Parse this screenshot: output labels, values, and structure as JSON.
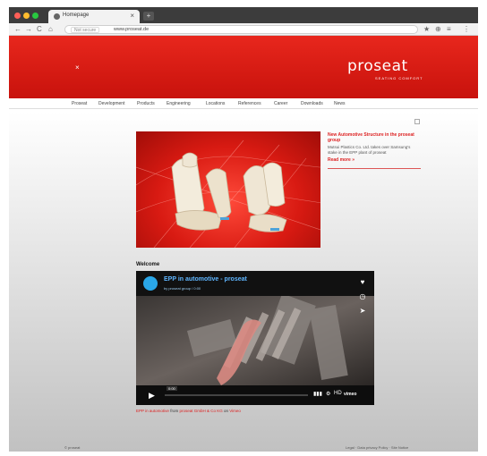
{
  "browser": {
    "tab_title": "Homepage",
    "tab_close": "×",
    "new_tab": "+",
    "nav_back": "←",
    "nav_forward": "→",
    "nav_reload": "C",
    "nav_home": "⌂",
    "url_secure": "Not secure",
    "url": "www.proseat.de",
    "ext_icons": [
      "★",
      "⊕",
      "≡",
      "⋮"
    ]
  },
  "header": {
    "mark": "×",
    "logo": "proseat",
    "tagline": "SEATING COMFORT"
  },
  "nav": {
    "items": [
      "Proseat",
      "Development",
      "Products",
      "Engineering",
      "Locations",
      "References",
      "Career",
      "Downloads",
      "News"
    ]
  },
  "side": {
    "title": "New Automotive Structure in the proseat group",
    "text": "Mutsui Plastics Co. Ltd. takes over Samsung's stake in the EPP plant of proseat",
    "more": "Read more »"
  },
  "welcome": "Welcome",
  "video": {
    "title": "EPP in automotive - proseat",
    "subtitle": "by proseat group / 0:00",
    "time": "0:00",
    "play_icon": "▶",
    "hd": "HD",
    "brand": "vimeo"
  },
  "caption": {
    "a": "EPP in automotive",
    "b": " from ",
    "c": "proseat GmbH & Co KG",
    "d": " on ",
    "e": "Vimeo"
  },
  "footer": {
    "left": "© proseat",
    "right": "Legal · Data privacy Policy · Site Notice"
  },
  "colors": {
    "brand_red": "#d8180f",
    "video_accent": "#2aa7e8"
  }
}
